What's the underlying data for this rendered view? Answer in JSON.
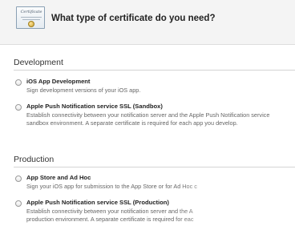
{
  "header": {
    "title": "What type of certificate do you need?",
    "icon_text": "Certificate"
  },
  "sections": [
    {
      "heading": "Development",
      "options": [
        {
          "label": "iOS App Development",
          "desc_lines": [
            "Sign development versions of your iOS app."
          ]
        },
        {
          "label": "Apple Push Notification service SSL (Sandbox)",
          "desc_lines": [
            "Establish connectivity between your notification server and the Apple Push Notification service",
            "sandbox environment. A separate certificate is required for each app you develop."
          ]
        }
      ]
    },
    {
      "heading": "Production",
      "options": [
        {
          "label": "App Store and Ad Hoc",
          "desc_lines": [
            "Sign your iOS app for submission to the App Store or for Ad Hoc c"
          ]
        },
        {
          "label": "Apple Push Notification service SSL (Production)",
          "desc_lines": [
            "Establish connectivity between your notification server and the A",
            "production environment. A separate certificate is required for eac"
          ]
        }
      ]
    }
  ]
}
